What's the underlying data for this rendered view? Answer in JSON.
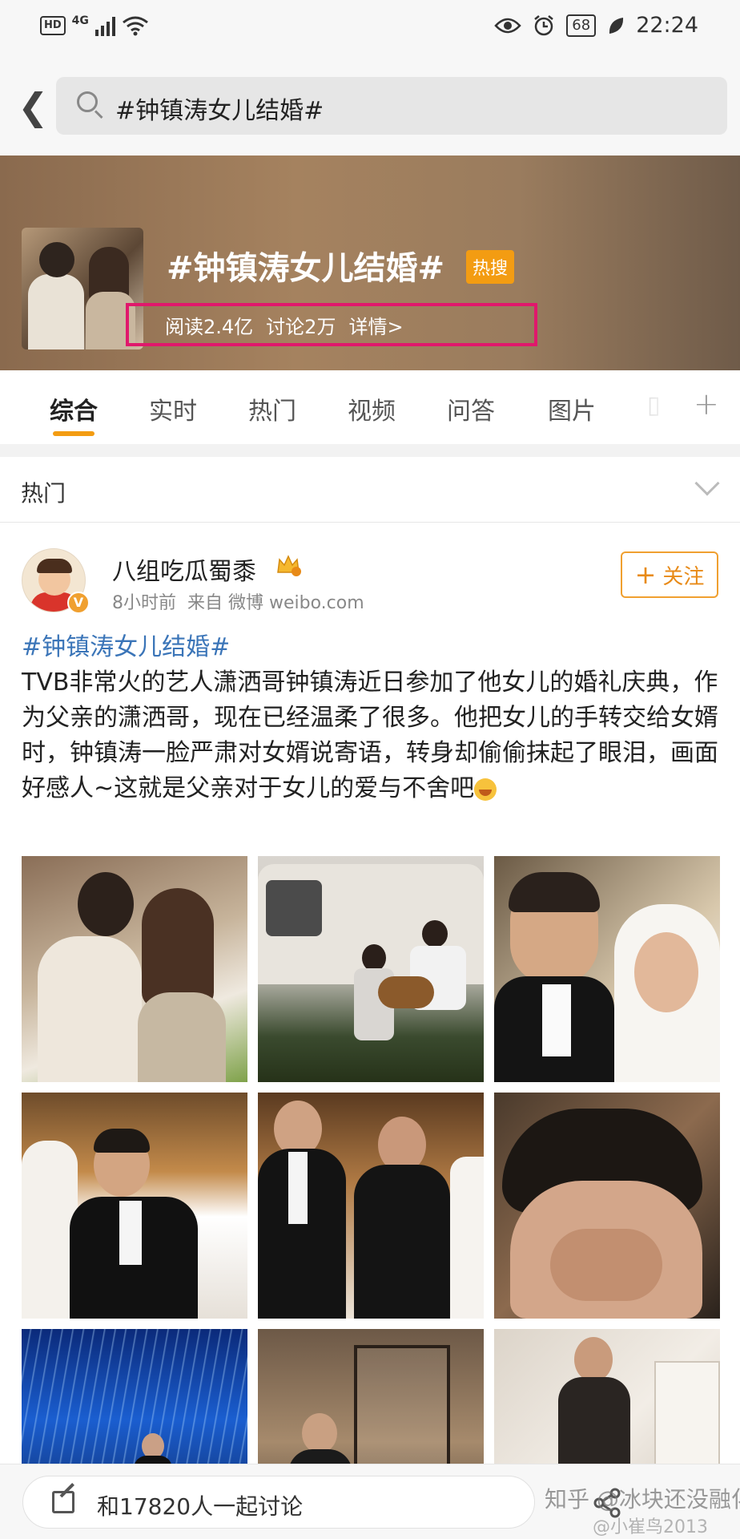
{
  "status_bar": {
    "hd": "HD",
    "network": "4G",
    "battery": "68",
    "time": "22:24"
  },
  "search": {
    "query": "#钟镇涛女儿结婚#"
  },
  "topic": {
    "title": "#钟镇涛女儿结婚#",
    "badge": "热搜",
    "reads": "阅读2.4亿",
    "discussions": "讨论2万",
    "details": "详情>"
  },
  "tabs": [
    "综合",
    "实时",
    "热门",
    "视频",
    "问答",
    "图片",
    "▯"
  ],
  "section": {
    "label": "热门"
  },
  "post": {
    "username": "八组吃瓜蜀黍",
    "time": "8小时前",
    "source": "来自 微博 weibo.com",
    "follow_label": "关注",
    "hashtag": "#钟镇涛女儿结婚#",
    "body": "TVB非常火的艺人潇洒哥钟镇涛近日参加了他女儿的婚礼庆典，作为父亲的潇洒哥，现在已经温柔了很多。他把女儿的手转交给女婿时，钟镇涛一脸严肃对女婿说寄语，转身却偷偷抹起了眼泪，画面好感人~这就是父亲对于女儿的爱与不舍吧",
    "emoji": "crying-face-icon",
    "image_count": 9
  },
  "bottom_bar": {
    "discuss_label": "和17820人一起讨论"
  },
  "watermark": {
    "line1": "知乎 @冰块还没融化",
    "line2": "@小崔鸟2013"
  },
  "colors": {
    "accent": "#f39c12",
    "hashtag": "#3b75b8",
    "highlight_box": "#e0186c",
    "follow": "#e88a17"
  }
}
